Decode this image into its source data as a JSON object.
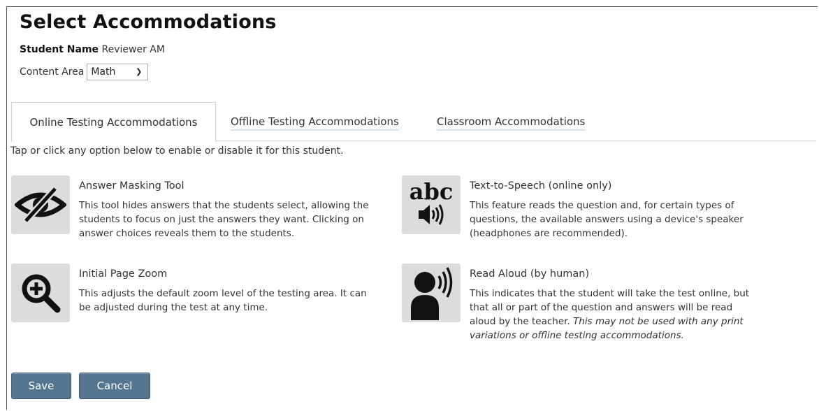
{
  "page": {
    "title": "Select Accommodations",
    "student_label": "Student Name",
    "student_value": "Reviewer AM",
    "content_area_label": "Content Area",
    "content_area_value": "Math"
  },
  "tabs": [
    {
      "label": "Online Testing Accommodations",
      "active": true
    },
    {
      "label": "Offline Testing Accommodations",
      "active": false
    },
    {
      "label": "Classroom Accommodations",
      "active": false
    }
  ],
  "instructions": "Tap or click any option below to enable or disable it for this student.",
  "accommodations": [
    {
      "title": "Answer Masking Tool",
      "icon": "eye-slash-icon",
      "desc_lines": [
        "This tool hides answers that the students select, allowing the",
        "students to focus on just the answers they want. Clicking on",
        "answer choices reveals them to the students."
      ]
    },
    {
      "title": "Text-to-Speech (online only)",
      "icon": "text-to-speech-icon",
      "desc_lines": [
        "This feature reads the question and, for certain types of",
        "questions, the available answers using a device's speaker",
        "(headphones are recommended)."
      ]
    },
    {
      "title": "Initial Page Zoom",
      "icon": "zoom-in-icon",
      "desc_lines": [
        "This adjusts the default zoom level of the testing area. It can",
        "be adjusted during the test at any time."
      ]
    },
    {
      "title": "Read Aloud (by human)",
      "icon": "speaking-person-icon",
      "desc_lines": [
        "This indicates that the student will take the test online, but",
        "that all or part of the question and answers will be read",
        "aloud by the teacher."
      ],
      "desc_italic_lines": [
        "This may not be used with any print",
        "variations or offline testing accommodations."
      ]
    }
  ],
  "icon_text": {
    "abc": "abc"
  },
  "buttons": {
    "save": "Save",
    "cancel": "Cancel"
  },
  "colors": {
    "button_bg": "#557590",
    "tab_underline": "#cfe2f1",
    "icon_bg": "#dcdcdc"
  }
}
